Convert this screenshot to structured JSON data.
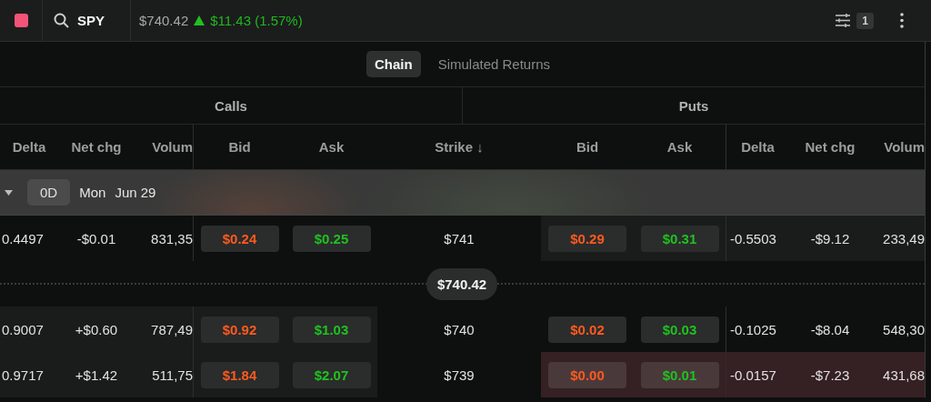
{
  "header": {
    "ticker": "SPY",
    "price": "$740.42",
    "change": "$11.43 (1.57%)",
    "filter_count": "1"
  },
  "tabs": [
    {
      "label": "Chain",
      "selected": true
    },
    {
      "label": "Simulated Returns",
      "selected": false
    }
  ],
  "sections": [
    "Calls",
    "Puts"
  ],
  "columns": {
    "calls": [
      "Delta",
      "Net chg",
      "Volum",
      "Bid",
      "Ask"
    ],
    "strike": "Strike ↓",
    "puts": [
      "Bid",
      "Ask",
      "Delta",
      "Net chg",
      "Volum"
    ]
  },
  "expiry": {
    "expanded": true,
    "badge": "0D",
    "day": "Mon",
    "date": "Jun 29"
  },
  "rows": [
    {
      "kind": "strike",
      "strike": "$741",
      "calls": {
        "delta": "0.4497",
        "net_chg": "-$0.01",
        "volume": "831,35",
        "bid": "$0.24",
        "ask": "$0.25",
        "itm": false,
        "selected": false
      },
      "puts": {
        "bid": "$0.29",
        "ask": "$0.31",
        "delta": "-0.5503",
        "net_chg": "-$9.12",
        "volume": "233,49",
        "itm": true,
        "selected": false
      }
    },
    {
      "kind": "price_line",
      "label": "$740.42"
    },
    {
      "kind": "strike",
      "strike": "$740",
      "calls": {
        "delta": "0.9007",
        "net_chg": "+$0.60",
        "volume": "787,49",
        "bid": "$0.92",
        "ask": "$1.03",
        "itm": true,
        "selected": false
      },
      "puts": {
        "bid": "$0.02",
        "ask": "$0.03",
        "delta": "-0.1025",
        "net_chg": "-$8.04",
        "volume": "548,30",
        "itm": false,
        "selected": false
      }
    },
    {
      "kind": "strike",
      "strike": "$739",
      "calls": {
        "delta": "0.9717",
        "net_chg": "+$1.42",
        "volume": "511,75",
        "bid": "$1.84",
        "ask": "$2.07",
        "itm": true,
        "selected": false
      },
      "puts": {
        "bid": "$0.00",
        "ask": "$0.01",
        "delta": "-0.0157",
        "net_chg": "-$7.23",
        "volume": "431,68",
        "itm": false,
        "selected": true
      }
    }
  ]
}
